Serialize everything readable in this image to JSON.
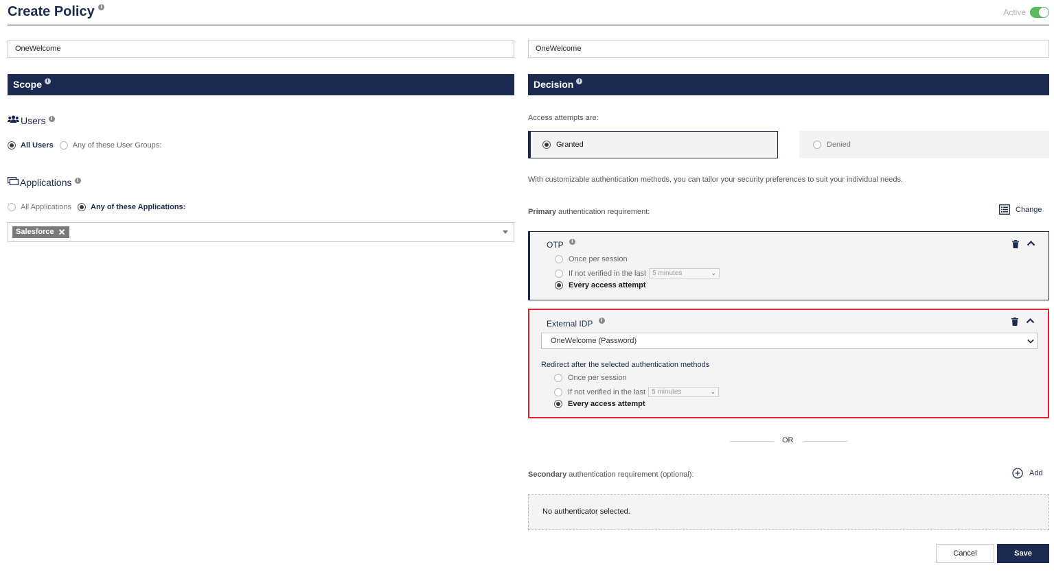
{
  "header": {
    "title": "Create Policy",
    "active_label": "Active",
    "active_on": true
  },
  "inputs": {
    "left_value": "OneWelcome",
    "right_value": "OneWelcome"
  },
  "scope": {
    "title": "Scope",
    "users": {
      "title": "Users",
      "options": [
        "All Users",
        "Any of these User Groups:"
      ],
      "selected": 0
    },
    "applications": {
      "title": "Applications",
      "options": [
        "All Applications",
        "Any of these Applications:"
      ],
      "selected": 1,
      "tags": [
        "Salesforce"
      ]
    }
  },
  "decision": {
    "title": "Decision",
    "access_label": "Access attempts are:",
    "granted_label": "Granted",
    "denied_label": "Denied",
    "selected": "granted",
    "description": "With customizable authentication methods, you can tailor your security preferences to suit your individual needs.",
    "primary_label_bold": "Primary",
    "primary_label_rest": " authentication requirement:",
    "change_label": "Change",
    "otp": {
      "title": "OTP",
      "options": [
        "Once per session",
        "If not verified in the last",
        "Every access attempt"
      ],
      "select_value": "5 minutes",
      "selected": 2
    },
    "external_idp": {
      "title": "External IDP",
      "dropdown_value": "OneWelcome (Password)",
      "redirect_label": "Redirect after the selected authentication methods",
      "options": [
        "Once per session",
        "If not verified in the last",
        "Every access attempt"
      ],
      "select_value": "5 minutes",
      "selected": 2
    },
    "or_label": "OR",
    "secondary_label_bold": "Secondary",
    "secondary_label_rest": " authentication requirement (optional):",
    "add_label": "Add",
    "no_authenticator": "No authenticator selected."
  },
  "footer": {
    "cancel_label": "Cancel",
    "save_label": "Save"
  },
  "colors": {
    "navy": "#1b2a4e",
    "toggle_green": "#5cb85c",
    "highlight_red": "#e0202a"
  }
}
